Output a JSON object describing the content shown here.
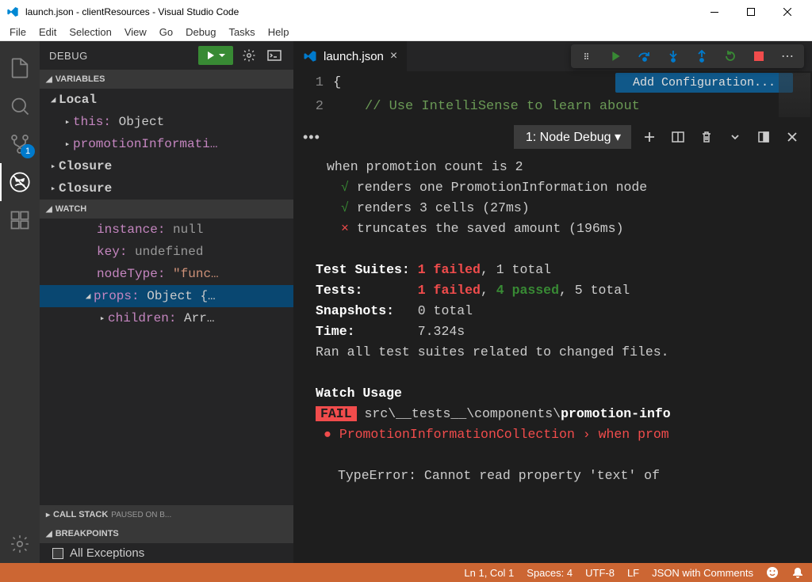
{
  "titlebar": {
    "title": "launch.json - clientResources - Visual Studio Code"
  },
  "menubar": [
    "File",
    "Edit",
    "Selection",
    "View",
    "Go",
    "Debug",
    "Tasks",
    "Help"
  ],
  "debug_header": {
    "title": "DEBUG"
  },
  "sections": {
    "variables": "VARIABLES",
    "watch": "WATCH",
    "callstack": "CALL STACK",
    "callstack_extra": "PAUSED ON B...",
    "breakpoints": "BREAKPOINTS"
  },
  "variables": {
    "local": {
      "label": "Local"
    },
    "this_name": "this",
    "this_val": "Object",
    "promo": "promotionInformati…",
    "closure1": "Closure",
    "closure2": "Closure"
  },
  "watch": {
    "instance_name": "instance",
    "instance_val": "null",
    "key_name": "key",
    "key_val": "undefined",
    "nodeType_name": "nodeType",
    "nodeType_val": "\"func…",
    "props_name": "props",
    "props_val": "Object {…",
    "children_name": "children",
    "children_val": "Arr…"
  },
  "breakpoints": {
    "all_exceptions": "All Exceptions"
  },
  "tabs": {
    "launch_json": "launch.json"
  },
  "code": {
    "line1_num": "1",
    "line2_num": "2",
    "brace": "{",
    "comment": "// Use IntelliSense to learn about",
    "add_config": "Add Configuration..."
  },
  "panel": {
    "selector": "1: Node Debug"
  },
  "terminal": {
    "l1_prefix": "when promotion count is 2",
    "l2_check": "√",
    "l2": "renders one PromotionInformation node",
    "l3_check": "√",
    "l3": "renders 3 cells (27ms)",
    "l4_x": "×",
    "l4": "truncates the saved amount (196ms)",
    "suites_label": "Test Suites:",
    "suites_fail": "1 failed",
    "suites_rest": ", 1 total",
    "tests_label": "Tests:",
    "tests_fail": "1 failed",
    "tests_pass": "4 passed",
    "tests_rest": ", 5 total",
    "snapshots_label": "Snapshots:",
    "snapshots_val": "0 total",
    "time_label": "Time:",
    "time_val": "7.324s",
    "ran": "Ran all test suites related to changed files.",
    "watch_usage": "Watch Usage",
    "fail_badge": "FAIL",
    "fail_path_pre": " src\\__tests__\\components\\",
    "fail_path_bold": "promotion-info",
    "bullet_line": "PromotionInformationCollection › when prom",
    "type_error": "TypeError: Cannot read property 'text' of"
  },
  "statusbar": {
    "cursor": "Ln 1, Col 1",
    "spaces": "Spaces: 4",
    "encoding": "UTF-8",
    "eol": "LF",
    "lang": "JSON with Comments"
  },
  "badges": {
    "scm": "1"
  }
}
